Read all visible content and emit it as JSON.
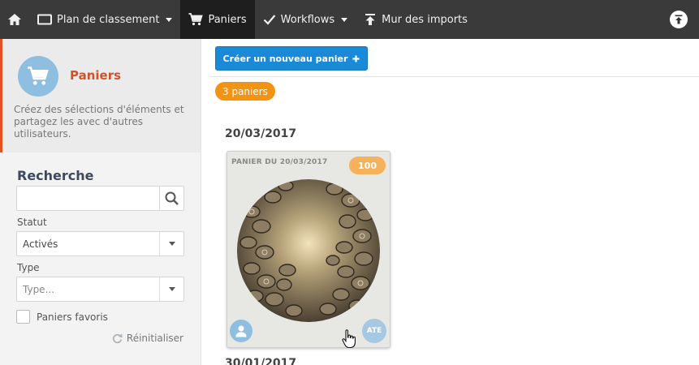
{
  "nav": {
    "items": [
      {
        "label": "Plan de classement",
        "icon": "folder-icon",
        "dropdown": true,
        "active": false
      },
      {
        "label": "Paniers",
        "icon": "cart-icon",
        "dropdown": false,
        "active": true
      },
      {
        "label": "Workflows",
        "icon": "check-icon",
        "dropdown": true,
        "active": false
      },
      {
        "label": "Mur des imports",
        "icon": "upload-icon",
        "dropdown": false,
        "active": false
      }
    ]
  },
  "sidebar": {
    "title": "Paniers",
    "description": "Créez des sélections d'éléments et partagez les avec d'autres utilisateurs.",
    "search": {
      "title": "Recherche",
      "value": "",
      "placeholder": ""
    },
    "status": {
      "label": "Statut",
      "value": "Activés"
    },
    "type": {
      "label": "Type",
      "value": "Type..."
    },
    "favorites": {
      "label": "Paniers favoris",
      "checked": false
    },
    "reset_label": "Réinitialiser"
  },
  "main": {
    "create_button": "Créer un nouveau panier",
    "count_badge": "3 paniers",
    "groups": [
      {
        "date": "20/03/2017",
        "cards": [
          {
            "title": "PANIER DU 20/03/2017",
            "count": "100",
            "owner": "ATE"
          }
        ]
      },
      {
        "date": "30/01/2017",
        "cards": []
      }
    ]
  },
  "colors": {
    "nav_bg": "#3a3a3a",
    "nav_active_bg": "#1e1e1e",
    "accent_orange": "#f39313",
    "title_red": "#d2532a",
    "primary_blue": "#1a8ad8",
    "avatar_blue": "#8fbfe0"
  }
}
